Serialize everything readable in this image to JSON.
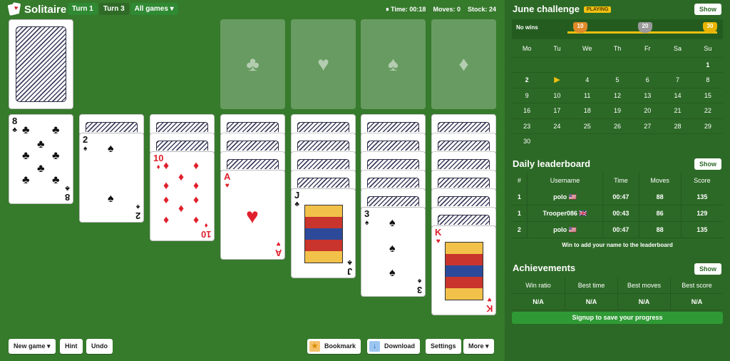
{
  "app": {
    "title": "Solitaire"
  },
  "modes": [
    "Turn 1",
    "Turn 3",
    "All games ▾"
  ],
  "status": {
    "time": "⏸ Time: 00:18",
    "moves": "Moves: 0",
    "stock": "Stock: 24"
  },
  "foundations": [
    {
      "suit": "♣"
    },
    {
      "suit": "♥"
    },
    {
      "suit": "♠"
    },
    {
      "suit": "♦"
    }
  ],
  "tableau": [
    {
      "hidden": 0,
      "rank": "8",
      "suit": "♣",
      "color": "blk"
    },
    {
      "hidden": 1,
      "rank": "2",
      "suit": "♠",
      "color": "blk"
    },
    {
      "hidden": 2,
      "rank": "10",
      "suit": "♦",
      "color": "red"
    },
    {
      "hidden": 3,
      "rank": "A",
      "suit": "♥",
      "color": "red"
    },
    {
      "hidden": 4,
      "rank": "J",
      "suit": "♣",
      "color": "blk"
    },
    {
      "hidden": 5,
      "rank": "3",
      "suit": "♠",
      "color": "blk"
    },
    {
      "hidden": 6,
      "rank": "K",
      "suit": "♥",
      "color": "red"
    }
  ],
  "buttons": {
    "new_game": "New game ▾",
    "hint": "Hint",
    "undo": "Undo",
    "bookmark": "Bookmark",
    "download": "Download",
    "settings": "Settings",
    "more": "More ▾"
  },
  "challenge": {
    "title": "June challenge",
    "badge": "PLAYING",
    "show": "Show",
    "progress_label": "No wins",
    "trophies": [
      "10",
      "20",
      "30"
    ],
    "trophy_colors": [
      "#e08a2a",
      "#9a9a9a",
      "#e8b400"
    ],
    "days_header": [
      "Mo",
      "Tu",
      "We",
      "Th",
      "Fr",
      "Sa",
      "Su"
    ],
    "weeks": [
      [
        "",
        "",
        "",
        "",
        "",
        "",
        "1"
      ],
      [
        "2",
        "▶",
        "4",
        "5",
        "6",
        "7",
        "8"
      ],
      [
        "9",
        "10",
        "11",
        "12",
        "13",
        "14",
        "15"
      ],
      [
        "16",
        "17",
        "18",
        "19",
        "20",
        "21",
        "22"
      ],
      [
        "23",
        "24",
        "25",
        "26",
        "27",
        "28",
        "29"
      ],
      [
        "30",
        "",
        "",
        "",
        "",
        "",
        ""
      ]
    ]
  },
  "leaderboard": {
    "title": "Daily leaderboard",
    "show": "Show",
    "headers": [
      "#",
      "Username",
      "Time",
      "Moves",
      "Score"
    ],
    "rows": [
      [
        "1",
        "polo 🇺🇸",
        "00:47",
        "88",
        "135"
      ],
      [
        "1",
        "Trooper086 🇬🇧",
        "00:43",
        "86",
        "129"
      ],
      [
        "2",
        "polo 🇺🇸",
        "00:47",
        "88",
        "135"
      ]
    ],
    "footer": "Win to add your name to the leaderboard"
  },
  "achievements": {
    "title": "Achievements",
    "show": "Show",
    "headers": [
      "Win ratio",
      "Best time",
      "Best moves",
      "Best score"
    ],
    "values": [
      "N/A",
      "N/A",
      "N/A",
      "N/A"
    ],
    "signup": "Signup to save your progress"
  }
}
